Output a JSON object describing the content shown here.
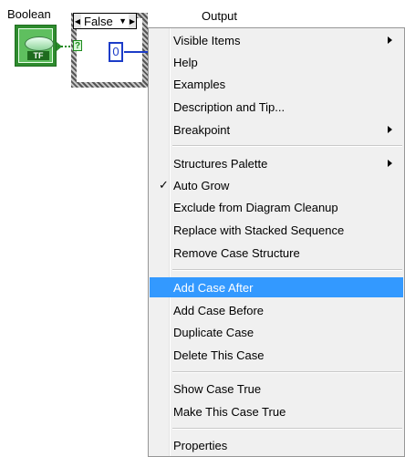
{
  "diagram": {
    "boolean_label": "Boolean",
    "output_label": "Output",
    "bool_terminal_text": "TF",
    "selector_terminal_text": "?",
    "case_selector_value": "False",
    "constant_value": "0"
  },
  "context_menu": {
    "items": [
      {
        "label": "Visible Items",
        "submenu": true
      },
      {
        "label": "Help"
      },
      {
        "label": "Examples"
      },
      {
        "label": "Description and Tip..."
      },
      {
        "label": "Breakpoint",
        "submenu": true
      },
      {
        "label": "Structures Palette",
        "submenu": true
      },
      {
        "label": "Auto Grow",
        "checked": true
      },
      {
        "label": "Exclude from Diagram Cleanup"
      },
      {
        "label": "Replace with Stacked Sequence"
      },
      {
        "label": "Remove Case Structure"
      },
      {
        "label": "Add Case After",
        "highlighted": true
      },
      {
        "label": "Add Case Before"
      },
      {
        "label": "Duplicate Case"
      },
      {
        "label": "Delete This Case"
      },
      {
        "label": "Show Case True"
      },
      {
        "label": "Make This Case True"
      },
      {
        "label": "Properties"
      }
    ],
    "checkmark": "✓",
    "highlight_color": "#3399ff"
  }
}
